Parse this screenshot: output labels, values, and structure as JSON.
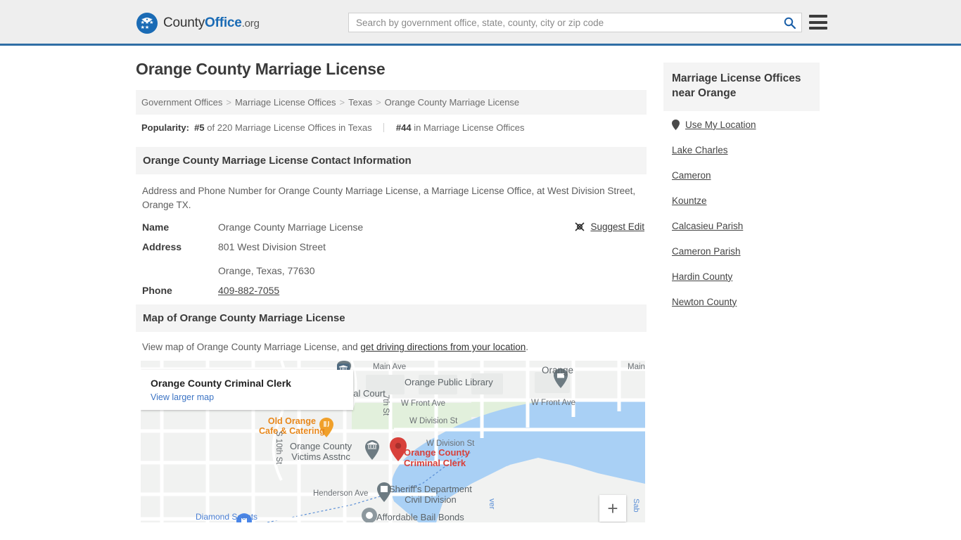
{
  "header": {
    "brand": {
      "county": "County",
      "office": "Office",
      "org": ".org"
    },
    "search": {
      "placeholder": "Search by government office, state, county, city or zip code",
      "value": "",
      "button_icon": "search-icon"
    },
    "menu_icon": "hamburger-menu-icon"
  },
  "main": {
    "title": "Orange County Marriage License",
    "breadcrumb": {
      "items": [
        "Government Offices",
        "Marriage License Offices",
        "Texas",
        "Orange County Marriage License"
      ],
      "separator": ">"
    },
    "popularity": {
      "label": "Popularity:",
      "rank_state": "#5",
      "rank_state_text": "of 220 Marriage License Offices in Texas",
      "rank_overall": "#44",
      "rank_overall_text": "in Marriage License Offices"
    },
    "contact_section": {
      "heading": "Orange County Marriage License Contact Information",
      "description": "Address and Phone Number for Orange County Marriage License, a Marriage License Office, at West Division Street, Orange TX.",
      "suggest_edit": "Suggest Edit",
      "rows": [
        {
          "label": "Name",
          "value": "Orange County Marriage License"
        },
        {
          "label": "Address",
          "value": "801 West Division Street",
          "value2": "Orange, Texas, 77630"
        },
        {
          "label": "Phone",
          "value": "409-882-7055"
        }
      ]
    },
    "map_section": {
      "heading": "Map of Orange County Marriage License",
      "desc_prefix": "View map of Orange County Marriage License, and ",
      "desc_link": "get driving directions from your location",
      "desc_suffix": ".",
      "card_title": "Orange County Criminal Clerk",
      "card_link": "View larger map",
      "zoom_in_label": "+",
      "labels": {
        "main_ave": "Main Ave",
        "main_right": "Main",
        "orange_public_library": "Orange Public Library",
        "orange_city": "Orange",
        "pal_court": "pal Court",
        "w_front_ave_left": "W Front Ave",
        "w_front_ave_right": "W Front Ave",
        "seventh_st": "7th St",
        "old_orange_cafe": "Old Orange\nCafe & Catering",
        "orange_county_victims": "Orange County\nVictims Asstnc",
        "s_tenth_st": "S 10th St",
        "w_division_st_left": "W Division St",
        "w_division_st_right": "W Division St",
        "criminal_clerk": "Orange County\nCriminal Clerk",
        "henderson_ave": "Henderson Ave",
        "sheriffs_dept": "Sheriff's Department\nCivil Division",
        "affordable_bail_bonds": "Affordable Bail Bonds",
        "diamond_scents": "Diamond Scents",
        "river": "ver",
        "sab": "Sab"
      }
    }
  },
  "sidebar": {
    "heading": "Marriage License Offices near Orange",
    "use_my_location": "Use My Location",
    "items": [
      "Lake Charles",
      "Cameron",
      "Kountze",
      "Calcasieu Parish",
      "Cameron Parish",
      "Hardin County",
      "Newton County"
    ]
  },
  "colors": {
    "brand_blue": "#1a6bb5",
    "header_border": "#2f6ea5",
    "link_blue": "#3b73c4",
    "map_marker_red": "#d8403a",
    "map_water": "#a9d0f5",
    "map_poi_orange": "#e8871a"
  }
}
